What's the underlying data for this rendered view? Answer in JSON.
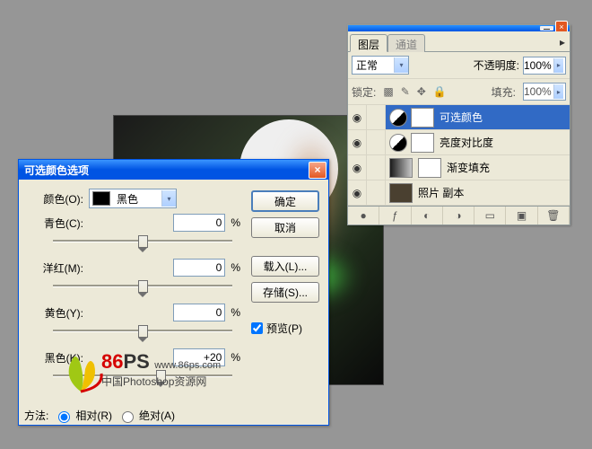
{
  "dialog": {
    "title": "可选颜色选项",
    "color_label": "颜色(O):",
    "color_value": "黑色",
    "sliders": {
      "cyan": {
        "label": "青色(C):",
        "value": "0"
      },
      "magenta": {
        "label": "洋红(M):",
        "value": "0"
      },
      "yellow": {
        "label": "黄色(Y):",
        "value": "0"
      },
      "black": {
        "label": "黑色(K):",
        "value": "+20"
      }
    },
    "percent": "%",
    "buttons": {
      "ok": "确定",
      "cancel": "取消",
      "load": "载入(L)...",
      "save": "存储(S)..."
    },
    "preview": "预览(P)",
    "method": {
      "label": "方法:",
      "relative": "相对(R)",
      "absolute": "绝对(A)"
    }
  },
  "panel": {
    "tabs": {
      "layers": "图层",
      "channels": "通道"
    },
    "blend_mode": "正常",
    "opacity_label": "不透明度:",
    "opacity_value": "100%",
    "fill_label": "填充:",
    "fill_value": "100%",
    "lock_label": "锁定:",
    "layers": [
      {
        "name": "可选颜色"
      },
      {
        "name": "亮度对比度"
      },
      {
        "name": "渐变填充"
      },
      {
        "name": "照片 副本"
      }
    ]
  },
  "watermark": {
    "site": "86",
    "suffix": "PS",
    "url": "www.86ps.com",
    "tagline": "中国Photoshop资源网"
  },
  "icons": {
    "eye": "◉",
    "circle": "●",
    "more": "▸",
    "lock_trans": "▩",
    "lock_brush": "✎",
    "lock_move": "✥",
    "lock_all": "🔒",
    "fx": "ƒ",
    "mask2": "◐",
    "folder": "▭",
    "adj": "◑",
    "new": "▣",
    "trash": "🗑"
  }
}
